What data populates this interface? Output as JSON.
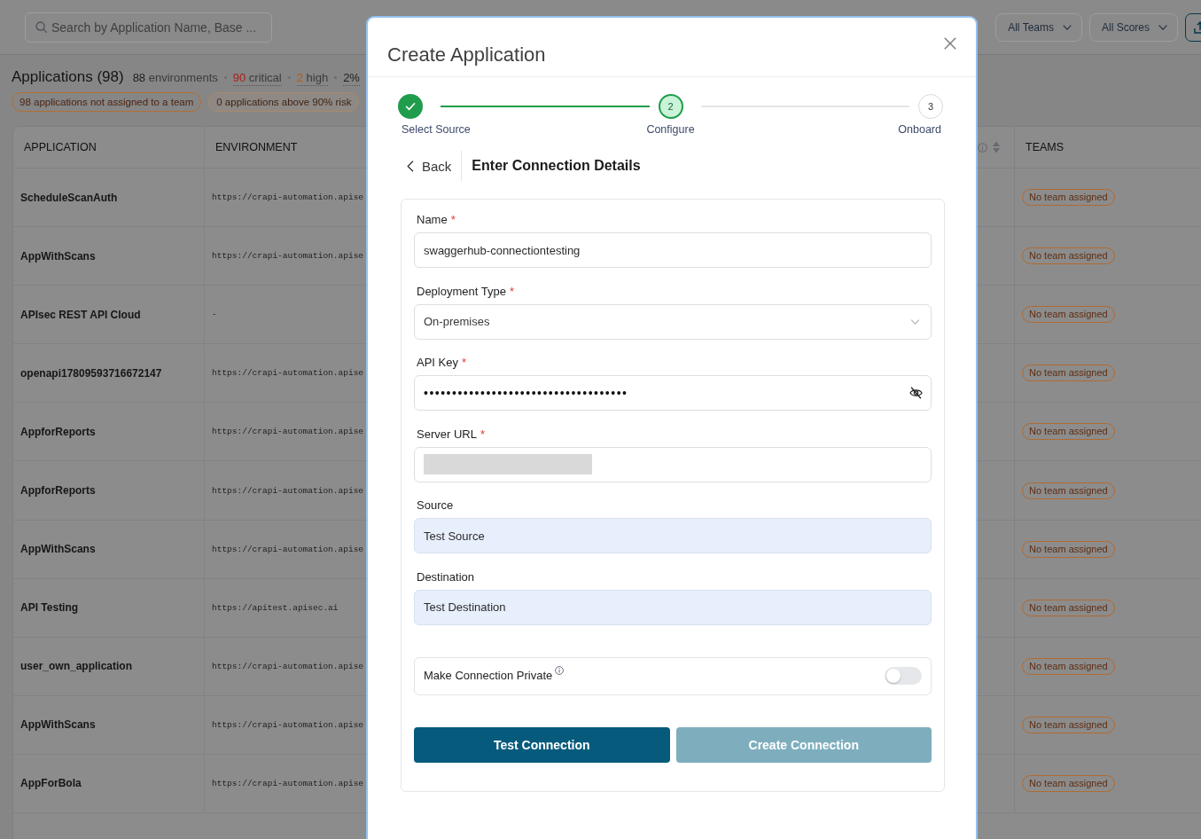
{
  "toolbar": {
    "search": {
      "placeholder": "Search by Application Name, Base ..."
    },
    "filters": [
      {
        "label": "All Teams"
      },
      {
        "label": "All Scores"
      }
    ]
  },
  "summary": {
    "title": "Applications (98)",
    "stats": [
      {
        "count": "88",
        "term": "environments",
        "color": "#1e1e1e",
        "dotted": false
      },
      {
        "count": "90",
        "term": "critical",
        "color": "#a8201c",
        "dotted": true
      },
      {
        "count": "2",
        "term": "high",
        "color": "#b85a14",
        "dotted": true
      },
      {
        "count": "2%",
        "color": "#1e1e1e",
        "dotted": true
      }
    ],
    "badges": [
      {
        "label": "98 applications not assigned to a team",
        "filled": false
      },
      {
        "label": "0 applications above 90% risk",
        "filled": true
      }
    ]
  },
  "table": {
    "columns": [
      {
        "kind": "text",
        "label": "APPLICATION"
      },
      {
        "kind": "text",
        "label": "ENVIRONMENT"
      },
      {
        "kind": "sortable"
      },
      {
        "kind": "text",
        "label": "TEAMS"
      }
    ],
    "rows": [
      {
        "application": "ScheduleScanAuth",
        "environment": "https://crapi-automation.apise",
        "team": "No team assigned"
      },
      {
        "application": "AppWithScans",
        "environment": "https://crapi-automation.apise",
        "team": "No team assigned"
      },
      {
        "application": "APIsec REST API Cloud",
        "environment": "-",
        "team": "No team assigned"
      },
      {
        "application": "openapi17809593716672147",
        "environment": "https://crapi-automation.apise",
        "team": "No team assigned"
      },
      {
        "application": "AppforReports",
        "environment": "https://crapi-automation.apise",
        "team": "No team assigned"
      },
      {
        "application": "AppforReports",
        "environment": "https://crapi-automation.apise",
        "team": "No team assigned"
      },
      {
        "application": "AppWithScans",
        "environment": "https://crapi-automation.apise",
        "team": "No team assigned"
      },
      {
        "application": "API Testing",
        "environment": "https://apitest.apisec.ai",
        "team": "No team assigned"
      },
      {
        "application": "user_own_application",
        "environment": "https://crapi-automation.apise",
        "team": "No team assigned"
      },
      {
        "application": "AppWithScans",
        "environment": "https://crapi-automation.apise",
        "team": "No team assigned"
      },
      {
        "application": "AppForBola",
        "environment": "https://crapi-automation.apise",
        "team": "No team assigned"
      }
    ]
  },
  "modal": {
    "title": "Create Application",
    "steps": [
      {
        "label": "Select Source",
        "completed": true,
        "selected": false
      },
      {
        "number": "2",
        "label": "Configure",
        "completed": false,
        "selected": true
      },
      {
        "number": "3",
        "label": "Onboard",
        "completed": false,
        "selected": false
      }
    ],
    "back": {
      "label": "Back"
    },
    "heading": "Enter Connection Details",
    "fields": [
      {
        "kind": "text",
        "label": "Name",
        "mark": "*",
        "value": "swaggerhub-connectiontesting",
        "readonly": false,
        "redacted": false
      },
      {
        "kind": "select",
        "label": "Deployment Type",
        "mark": "*",
        "value": "On-premises",
        "readonly": false,
        "redacted": false
      },
      {
        "kind": "secret",
        "label": "API Key",
        "mark": "*",
        "value": "••••••••••••••••••••••••••••••••••••",
        "readonly": false,
        "redacted": false
      },
      {
        "kind": "text",
        "label": "Server URL",
        "mark": "*",
        "readonly": false,
        "redacted": true
      },
      {
        "kind": "text",
        "label": "Source",
        "value": "Test Source",
        "readonly": true,
        "redacted": false
      },
      {
        "kind": "text",
        "label": "Destination",
        "value": "Test Destination",
        "readonly": true,
        "redacted": false
      }
    ],
    "private_toggle": {
      "label": "Make Connection Private",
      "on": false
    },
    "buttons": [
      {
        "label": "Test Connection",
        "disabled": false
      },
      {
        "label": "Create Connection",
        "disabled": true
      }
    ]
  }
}
